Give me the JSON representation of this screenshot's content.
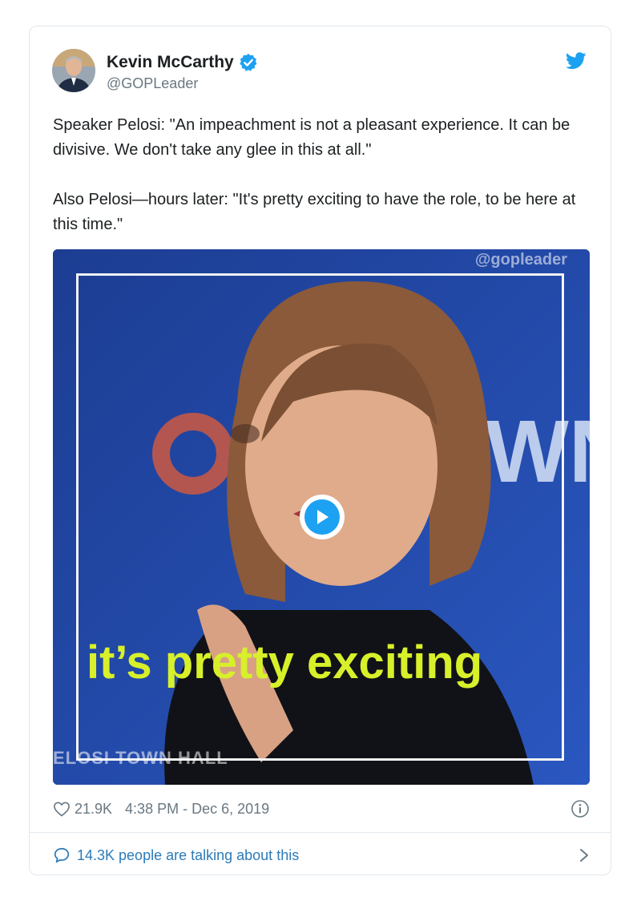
{
  "author": {
    "display_name": "Kevin McCarthy",
    "handle": "@GOPLeader",
    "verified_icon": "verified-badge-icon",
    "avatar_icon": "profile-photo"
  },
  "tweet": {
    "paragraph_1": "Speaker Pelosi: \"An impeachment is not a pleasant experience. It can be divisive. We don't take any glee in this at all.\"",
    "paragraph_2": "Also Pelosi—hours later: \"It's pretty exciting to have the role, to be here at this time.\""
  },
  "media": {
    "watermark": "@gopleader",
    "caption": "it’s pretty exciting",
    "lower_third": "ELOSI TOWN HALL",
    "play_icon": "play-icon"
  },
  "meta": {
    "likes": "21.9K",
    "timestamp": "4:38 PM - Dec 6, 2019"
  },
  "footer": {
    "talking": "14.3K people are talking about this"
  },
  "colors": {
    "twitter_blue": "#1da1f2",
    "link_blue": "#2b7bb9",
    "caption_yellow": "#d7f02a",
    "background_blue": "#1a3f9a"
  }
}
